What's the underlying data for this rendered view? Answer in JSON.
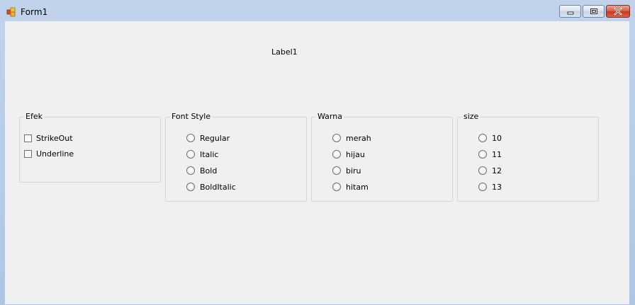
{
  "window": {
    "title": "Form1",
    "icon": "winforms-app-icon",
    "controls": {
      "minimize": "minimize-icon",
      "maximize": "maximize-icon",
      "close": "close-icon"
    }
  },
  "form": {
    "label1": "Label1",
    "groups": {
      "efek": {
        "title": "Efek",
        "options": [
          "StrikeOut",
          "Underline"
        ]
      },
      "font_style": {
        "title": "Font Style",
        "options": [
          "Regular",
          "Italic",
          "Bold",
          "BoldItalic"
        ]
      },
      "warna": {
        "title": "Warna",
        "options": [
          "merah",
          "hijau",
          "biru",
          "hitam"
        ]
      },
      "size": {
        "title": "size",
        "options": [
          "10",
          "11",
          "12",
          "13"
        ]
      }
    }
  },
  "colors": {
    "client_bg": "#f0f0f0",
    "close_button": "#c4381f",
    "titlebar": "#c0d3ea"
  }
}
